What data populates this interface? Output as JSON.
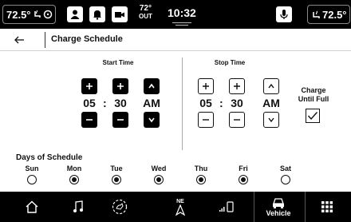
{
  "status_bar": {
    "left_temp": "72.5°",
    "outside_temp": "72°",
    "outside_label": "OUT",
    "clock": "10:32",
    "right_temp": "72.5°",
    "icons": [
      "heated-seat-icon",
      "steering-heat-icon",
      "profile-icon",
      "bell-icon",
      "camera-icon",
      "microphone-icon",
      "fan-icon"
    ]
  },
  "header": {
    "title": "Charge Schedule",
    "back_icon": "back-arrow-icon"
  },
  "start_time": {
    "label": "Start Time",
    "hour": "05",
    "minute": "30",
    "ampm": "AM",
    "colon": ":"
  },
  "stop_time": {
    "label": "Stop Time",
    "hour": "05",
    "minute": "30",
    "ampm": "AM",
    "colon": ":"
  },
  "charge_until_full": {
    "label_line1": "Charge",
    "label_line2": "Until Full",
    "checked": true
  },
  "days": {
    "title": "Days of Schedule",
    "items": [
      {
        "label": "Sun",
        "selected": false
      },
      {
        "label": "Mon",
        "selected": true
      },
      {
        "label": "Tue",
        "selected": true
      },
      {
        "label": "Wed",
        "selected": true
      },
      {
        "label": "Thu",
        "selected": true
      },
      {
        "label": "Fri",
        "selected": true
      },
      {
        "label": "Sat",
        "selected": false
      }
    ]
  },
  "bottom_nav": {
    "compass": "NE",
    "vehicle_label": "Vehicle",
    "items": [
      "home-icon",
      "music-icon",
      "hands-free-icon",
      "navigation-icon",
      "phone-icon",
      "vehicle-icon",
      "apps-grid-icon"
    ]
  }
}
